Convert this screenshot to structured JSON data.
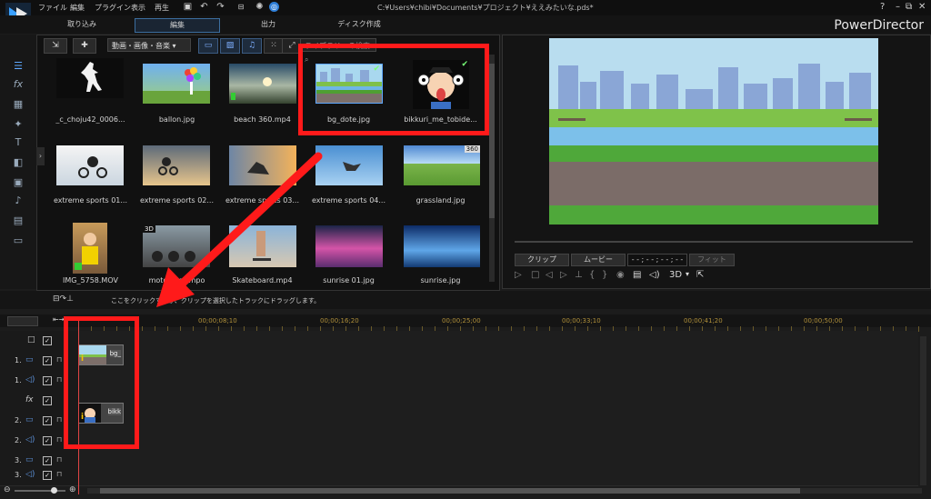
{
  "menu": {
    "items": [
      "ファイル",
      "編集",
      "プラグイン",
      "表示",
      "再生"
    ],
    "title_path": "C:¥Users¥chibi¥Documents¥プロジェクト¥ええみたいな.pds*"
  },
  "window": {
    "help": "?",
    "minimize": "–",
    "restore": "⧉",
    "close": "✕"
  },
  "tabs": [
    {
      "label": "取り込み"
    },
    {
      "label": "編集",
      "active": true
    },
    {
      "label": "出力"
    },
    {
      "label": "ディスク作成"
    }
  ],
  "brand": "PowerDirector",
  "library": {
    "filter": "動画・画像・音楽",
    "filter_arrow": "▾",
    "search_placeholder": "ライブラリーの検索",
    "expander": "›",
    "items": [
      {
        "caption": "_c_choju42_0006...",
        "badge": ""
      },
      {
        "caption": "ballon.jpg",
        "badge": ""
      },
      {
        "caption": "beach 360.mp4",
        "badge": ""
      },
      {
        "caption": "bg_dote.jpg",
        "badge": ""
      },
      {
        "caption": "bikkuri_me_tobide...",
        "badge": ""
      },
      {
        "caption": "extreme sports 01...",
        "badge": ""
      },
      {
        "caption": "extreme sports 02...",
        "badge": ""
      },
      {
        "caption": "extreme sports 03...",
        "badge": ""
      },
      {
        "caption": "extreme sports 04...",
        "badge": ""
      },
      {
        "caption": "grassland.jpg",
        "badge": "360"
      },
      {
        "caption": "IMG_5758.MOV",
        "badge": ""
      },
      {
        "caption": "motocross.mpo",
        "badge": "3D"
      },
      {
        "caption": "Skateboard.mp4",
        "badge": ""
      },
      {
        "caption": "sunrise 01.jpg",
        "badge": ""
      },
      {
        "caption": "sunrise.jpg",
        "badge": ""
      }
    ]
  },
  "preview": {
    "clip_btn": "クリップ",
    "movie_btn": "ムービー",
    "timecode": "- - ; - - ; - - ; - -",
    "fit": "フィット",
    "mode_3d": "3D"
  },
  "timeline": {
    "hint": "ここをクリックするか、クリップを選択したトラックにドラッグします。",
    "ruler": [
      "00;00;08;10",
      "00;00;16;20",
      "00;00;25;00",
      "00;00;33;10",
      "00;00;41;20",
      "00;00;50;00"
    ],
    "tracks": [
      {
        "num": "",
        "type": "master"
      },
      {
        "num": "1.",
        "type": "video",
        "clip": "bg_"
      },
      {
        "num": "1.",
        "type": "audio"
      },
      {
        "num": "",
        "type": "fx"
      },
      {
        "num": "2.",
        "type": "video",
        "clip": "bikk"
      },
      {
        "num": "2.",
        "type": "audio"
      },
      {
        "num": "3.",
        "type": "video"
      },
      {
        "num": "3.",
        "type": "audio"
      }
    ]
  },
  "colors": {
    "accent": "#2f7fd8",
    "annotation": "#ff1a1a",
    "ruler": "#b0903a"
  }
}
